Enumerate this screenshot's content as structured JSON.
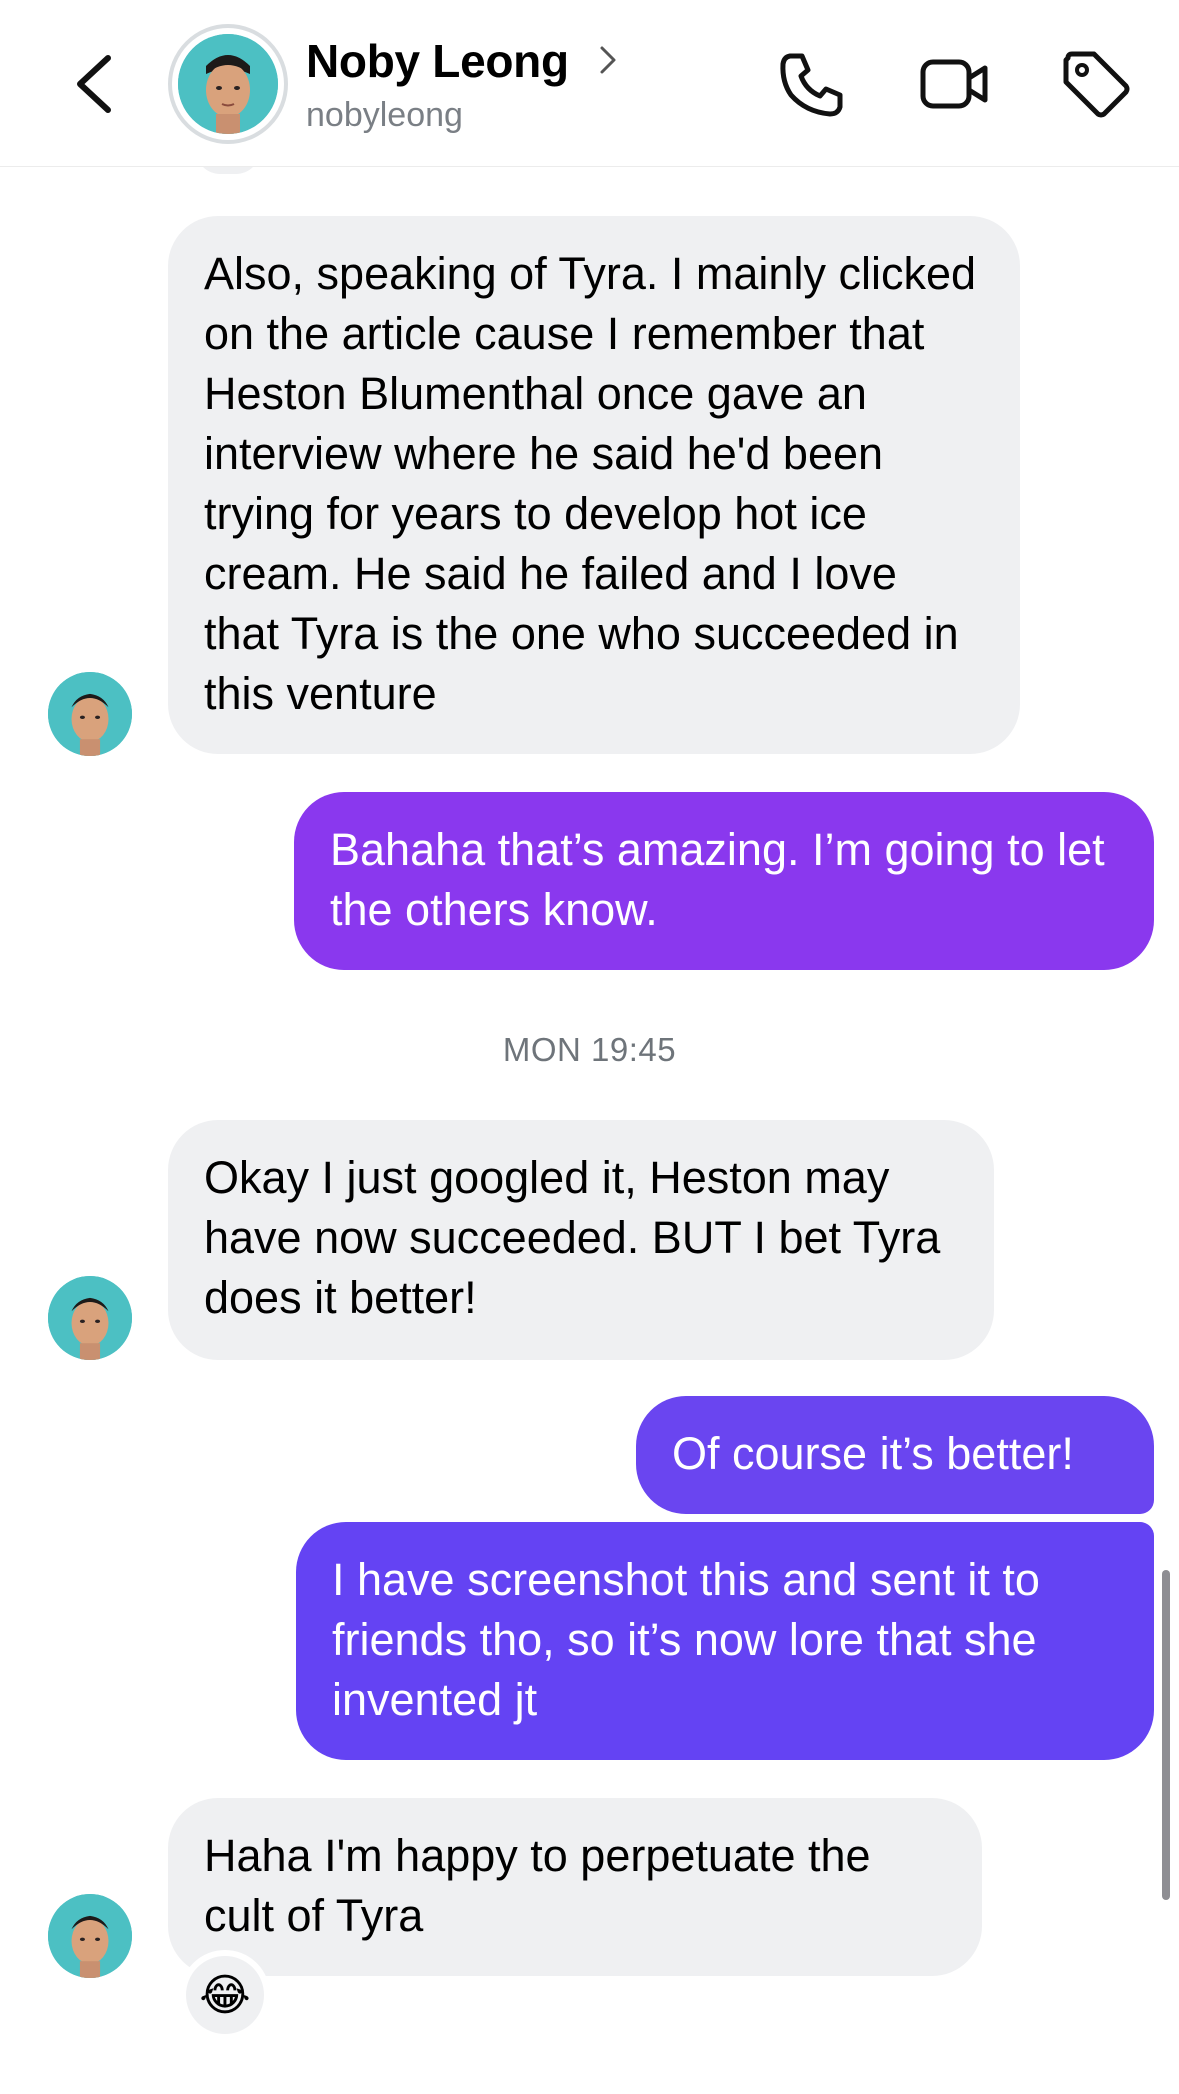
{
  "header": {
    "name": "Noby Leong",
    "handle": "nobyleong"
  },
  "messages": [
    {
      "from": "them",
      "text": "Also, speaking of Tyra. I mainly clicked on the article cause I remember that Heston Blumenthal once gave an interview where he said he'd been trying for years to develop hot ice cream. He said he failed and I love that Tyra is the one who succeeded in this venture"
    },
    {
      "from": "me",
      "text": "Bahaha that’s amazing. I’m going to let the others know."
    },
    {
      "from": "them",
      "text": "Okay I just googled it, Heston may have now succeeded. BUT I bet Tyra does it better!"
    },
    {
      "from": "me",
      "text": "Of course it’s better!"
    },
    {
      "from": "me",
      "text": "I have screenshot this and sent it to friends tho, so it’s now lore that she invented jt"
    },
    {
      "from": "them",
      "text": "Haha I'm happy to perpetuate the cult of Tyra"
    }
  ],
  "timestamp": "MON 19:45",
  "reaction": "😂",
  "colors": {
    "incoming_bubble": "#eff0f2",
    "outgoing_1": "#8a38ee",
    "outgoing_2": "#6a45f0",
    "outgoing_3": "#6443f3",
    "avatar_bg": "#4cc0c3"
  }
}
